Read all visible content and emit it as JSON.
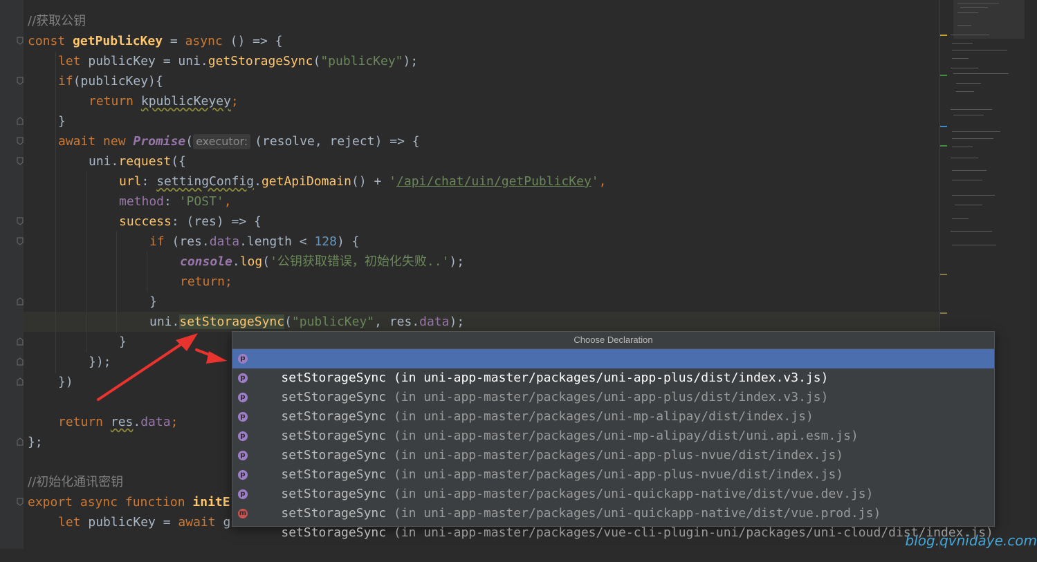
{
  "code_lines": {
    "l1": "//获取公钥",
    "l2_kw": "const ",
    "l2_fn": "getPublicKey",
    "l2_mid": " = ",
    "l2_async": "async",
    "l2_end": " () => {",
    "l3_kw": "let ",
    "l3_a": "publicKey = uni.",
    "l3_fn": "getStorageSync",
    "l3_p1": "(",
    "l3_str": "\"publicKey\"",
    "l3_end": ");",
    "l4_kw": "if",
    "l4_rest": "(publicKey){",
    "l5_kw": "return ",
    "l5_err": "kpublicKeyey",
    "l5_end": ";",
    "l6": "}",
    "l7_kw1": "await ",
    "l7_kw2": "new ",
    "l7_cls": "Promise",
    "l7_p": "(",
    "l7_hint": "executor:",
    "l7_rest": "(resolve, reject) => {",
    "l8_a": "uni.",
    "l8_fn": "request",
    "l8_end": "({",
    "l9_prop": "url",
    "l9_c": ": ",
    "l9_cfg": "settingConfig",
    "l9_dot": ".",
    "l9_fn": "getApiDomain",
    "l9_mid": "() + ",
    "l9_q1": "'",
    "l9_url": "/api/chat/uin/getPublicKey",
    "l9_q2": "'",
    "l9_end": ",",
    "l10_prop": "method",
    "l10_c": ": ",
    "l10_str": "'POST'",
    "l10_end": ",",
    "l11_fn": "success",
    "l11_rest": ": (res) => {",
    "l12_kw": "if ",
    "l12_a": "(res.",
    "l12_prop": "data",
    "l12_b": ".length < ",
    "l12_num": "128",
    "l12_end": ") {",
    "l13_obj": "console",
    "l13_dot": ".",
    "l13_fn": "log",
    "l13_p": "(",
    "l13_str": "'公钥获取错误，初始化失败..'",
    "l13_end": ");",
    "l14_kw": "return",
    "l14_end": ";",
    "l15": "}",
    "l16_a": "uni.",
    "l16_fn": "setStorageSync",
    "l16_p": "(",
    "l16_str": "\"publicKey\"",
    "l16_b": ", res.",
    "l16_prop": "data",
    "l16_end": ");",
    "l17": "}",
    "l18": "});",
    "l19": "})",
    "l20_kw": "return ",
    "l20_res": "res",
    "l20_dot": ".",
    "l20_prop": "data",
    "l20_end": ";",
    "l21": "};",
    "l22": "//初始化通讯密钥",
    "l23_kw": "export async function ",
    "l23_fn": "initE",
    "l24_kw": "let ",
    "l24_a": "publicKey = ",
    "l24_kw2": "await ",
    "l24_b": "g"
  },
  "popup": {
    "title": "Choose Declaration",
    "items": [
      {
        "name": "setStorageSync",
        "location": " (in uni-app-master/packages/uni-app-plus/dist/index.v3.js)",
        "icon": "p"
      },
      {
        "name": "setStorageSync",
        "location": " (in uni-app-master/packages/uni-app-plus/dist/index.v3.js)",
        "icon": "p"
      },
      {
        "name": "setStorageSync",
        "location": " (in uni-app-master/packages/uni-mp-alipay/dist/index.js)",
        "icon": "p"
      },
      {
        "name": "setStorageSync",
        "location": " (in uni-app-master/packages/uni-mp-alipay/dist/uni.api.esm.js)",
        "icon": "p"
      },
      {
        "name": "setStorageSync",
        "location": " (in uni-app-master/packages/uni-app-plus-nvue/dist/index.js)",
        "icon": "p"
      },
      {
        "name": "setStorageSync",
        "location": " (in uni-app-master/packages/uni-app-plus-nvue/dist/index.js)",
        "icon": "p"
      },
      {
        "name": "setStorageSync",
        "location": " (in uni-app-master/packages/uni-quickapp-native/dist/vue.dev.js)",
        "icon": "p"
      },
      {
        "name": "setStorageSync",
        "location": " (in uni-app-master/packages/uni-quickapp-native/dist/vue.prod.js)",
        "icon": "p"
      },
      {
        "name": "setStorageSync",
        "location": " (in uni-app-master/packages/vue-cli-plugin-uni/packages/uni-cloud/dist/index.js)",
        "icon": "m"
      }
    ]
  },
  "watermark": "blog.qvnidaye.com",
  "colors": {
    "selection": "#4b6eaf",
    "arrow": "#e8332f",
    "keyword": "#cc7832",
    "function": "#ffc66d",
    "string": "#6a8759"
  }
}
